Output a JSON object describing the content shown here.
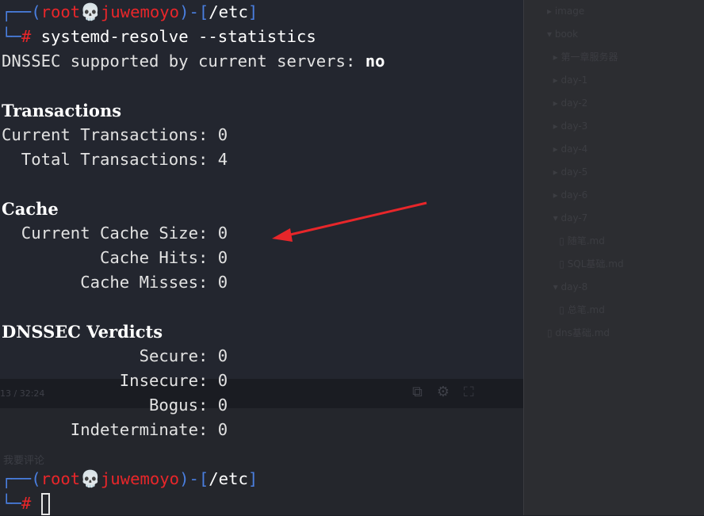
{
  "terminal": {
    "prompt_user": "root",
    "prompt_skull": "💀",
    "prompt_host": "juwemoyo",
    "prompt_cwd": "/etc",
    "prompt_symbol": "#",
    "command": "systemd-resolve --statistics",
    "dnssec_line_label": "DNSSEC supported by current servers: ",
    "dnssec_line_value": "no",
    "transactions_heading": "Transactions",
    "current_transactions": "Current Transactions: 0",
    "total_transactions": "  Total Transactions: 4",
    "cache_heading": "Cache",
    "current_cache_size": "  Current Cache Size: 0",
    "cache_hits": "          Cache Hits: 0",
    "cache_misses": "        Cache Misses: 0",
    "dnssec_heading": "DNSSEC Verdicts",
    "secure": "              Secure: 0",
    "insecure": "            Insecure: 0",
    "bogus": "               Bogus: 0",
    "indeterminate": "       Indeterminate: 0"
  },
  "background": {
    "video_time": "13 / 32:24",
    "comment_label": "我要评论",
    "file_tree": [
      "image",
      "book",
      "第一章服务器",
      "day-1",
      "day-2",
      "day-3",
      "day-4",
      "day-5",
      "day-6",
      "day-7",
      "随笔.md",
      "SQL基础.md",
      "day-8",
      "总笔.md",
      "dns基础.md"
    ]
  },
  "annotation": {
    "arrow_color": "#e8262a"
  }
}
